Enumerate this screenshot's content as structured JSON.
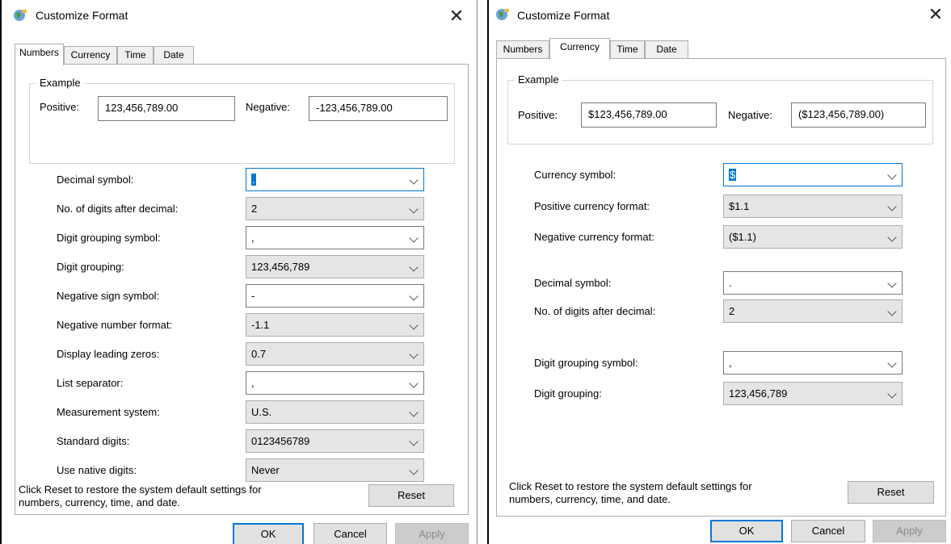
{
  "window_title": "Customize Format",
  "tabs": [
    "Numbers",
    "Currency",
    "Time",
    "Date"
  ],
  "numbers": {
    "active_tab": "Numbers",
    "example": {
      "legend": "Example",
      "positive_label": "Positive:",
      "positive_value": "123,456,789.00",
      "negative_label": "Negative:",
      "negative_value": "-123,456,789.00"
    },
    "rows": [
      {
        "label": "Decimal symbol:",
        "value": ".",
        "editable": true,
        "focused": true
      },
      {
        "label": "No. of digits after decimal:",
        "value": "2",
        "editable": false
      },
      {
        "label": "Digit grouping symbol:",
        "value": ",",
        "editable": true
      },
      {
        "label": "Digit grouping:",
        "value": "123,456,789",
        "editable": false
      },
      {
        "label": "Negative sign symbol:",
        "value": "-",
        "editable": true
      },
      {
        "label": "Negative number format:",
        "value": "-1.1",
        "editable": false
      },
      {
        "label": "Display leading zeros:",
        "value": "0.7",
        "editable": false
      },
      {
        "label": "List separator:",
        "value": ",",
        "editable": true
      },
      {
        "label": "Measurement system:",
        "value": "U.S.",
        "editable": false
      },
      {
        "label": "Standard digits:",
        "value": "0123456789",
        "editable": false
      },
      {
        "label": "Use native digits:",
        "value": "Never",
        "editable": false
      }
    ]
  },
  "currency": {
    "active_tab": "Currency",
    "example": {
      "legend": "Example",
      "positive_label": "Positive:",
      "positive_value": "$123,456,789.00",
      "negative_label": "Negative:",
      "negative_value": "($123,456,789.00)"
    },
    "rows": [
      {
        "label": "Currency symbol:",
        "value": "$",
        "editable": true,
        "focused": true
      },
      {
        "label": "Positive currency format:",
        "value": "$1.1",
        "editable": false
      },
      {
        "label": "Negative currency format:",
        "value": "($1.1)",
        "editable": false
      },
      {
        "label": "Decimal symbol:",
        "value": ".",
        "editable": true
      },
      {
        "label": "No. of digits after decimal:",
        "value": "2",
        "editable": false
      },
      {
        "label": "Digit grouping symbol:",
        "value": ",",
        "editable": true
      },
      {
        "label": "Digit grouping:",
        "value": "123,456,789",
        "editable": false
      }
    ]
  },
  "footer": {
    "reset_hint_line1": "Click Reset to restore the system default settings for",
    "reset_hint_line2": "numbers, currency, time, and date.",
    "reset_label": "Reset",
    "ok_label": "OK",
    "cancel_label": "Cancel",
    "apply_label": "Apply"
  },
  "colors": {
    "accent": "#0078d7",
    "readonly_combo_bg": "#e5e5e5",
    "disabled_button_bg": "#cccccc"
  }
}
